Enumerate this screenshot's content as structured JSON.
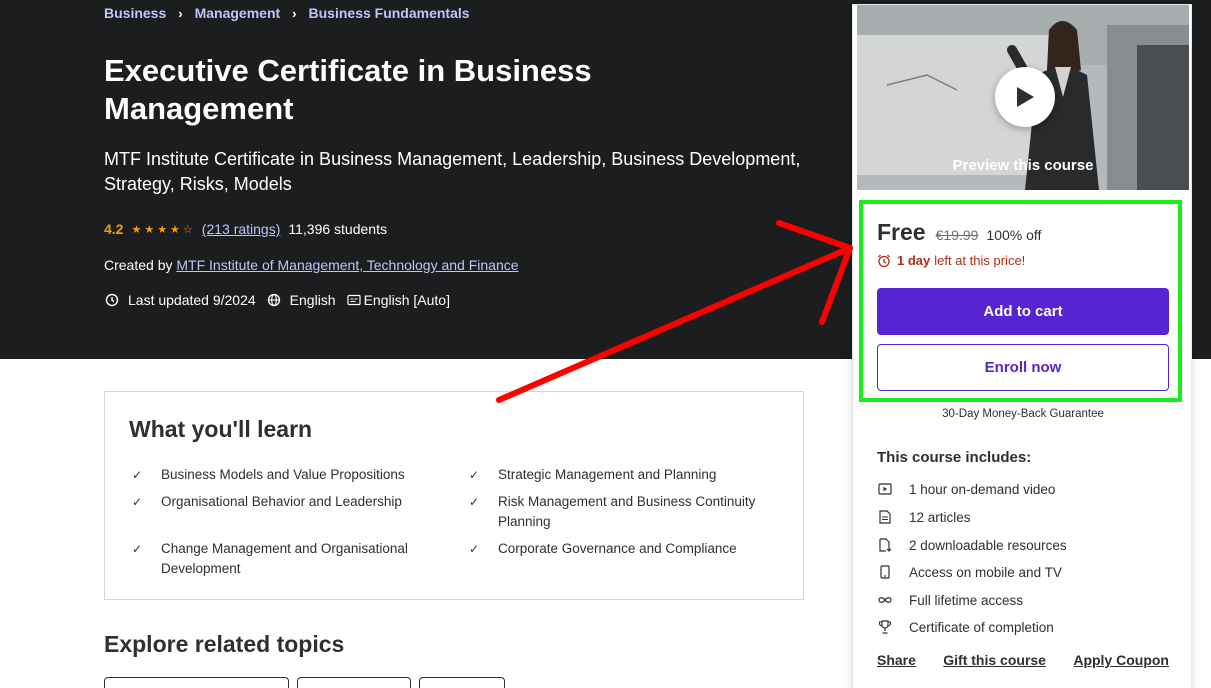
{
  "breadcrumb": [
    "Business",
    "Management",
    "Business Fundamentals"
  ],
  "course": {
    "title": "Executive Certificate in Business Management",
    "subtitle": "MTF Institute Certificate in Business Management, Leadership, Business Development, Strategy, Risks, Models",
    "rating": "4.2",
    "ratings_count": "(213 ratings)",
    "students": "11,396 students",
    "created_by_label": "Created by",
    "author": "MTF Institute of Management, Technology and Finance",
    "last_updated": "Last updated 9/2024",
    "language": "English",
    "captions": "English [Auto]"
  },
  "learn": {
    "title": "What you'll learn",
    "items": [
      "Business Models and Value Propositions",
      "Strategic Management and Planning",
      "Organisational Behavior and Leadership",
      "Risk Management and Business Continuity Planning",
      "Change Management and Organisational Development",
      "Corporate Governance and Compliance"
    ]
  },
  "related_title": "Explore related topics",
  "sidebar": {
    "preview_label": "Preview this course",
    "price": "Free",
    "original_price": "€19.99",
    "discount": "100% off",
    "countdown_bold": "1 day",
    "countdown_text": "left at this price!",
    "add_to_cart": "Add to cart",
    "enroll_now": "Enroll now",
    "guarantee": "30-Day Money-Back Guarantee",
    "includes_title": "This course includes:",
    "includes": [
      {
        "icon": "video-icon",
        "text": "1 hour on-demand video"
      },
      {
        "icon": "article-icon",
        "text": "12 articles"
      },
      {
        "icon": "download-file-icon",
        "text": "2 downloadable resources"
      },
      {
        "icon": "mobile-icon",
        "text": "Access on mobile and TV"
      },
      {
        "icon": "infinity-icon",
        "text": "Full lifetime access"
      },
      {
        "icon": "trophy-icon",
        "text": "Certificate of completion"
      }
    ],
    "links": [
      "Share",
      "Gift this course",
      "Apply Coupon"
    ]
  },
  "colors": {
    "hero_bg": "#1c1d1f",
    "link_purple": "#c0c4fc",
    "star": "#f69c08",
    "primary": "#5624d0",
    "alert": "#b32d0f",
    "annotation_box": "#1aee1a",
    "annotation_arrow": "#ff0000"
  }
}
